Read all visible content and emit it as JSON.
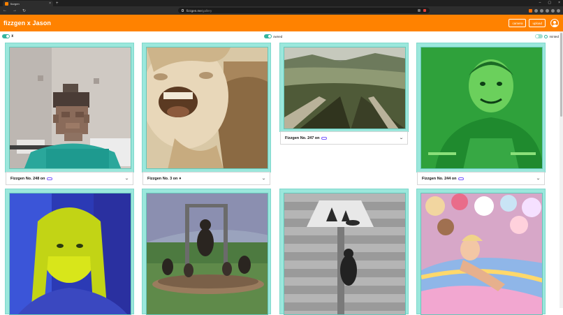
{
  "browser": {
    "tab_title": "fizzgen",
    "url_host": "fizzgen.me",
    "url_path": "/gallery"
  },
  "app": {
    "brand": "fizzgen x Jason",
    "camera_label": "camera",
    "upload_label": "upload"
  },
  "filters": {
    "owned_label": "owned",
    "minted_label": "minted"
  },
  "cards": [
    {
      "title": "Fizzgen No. 248 on",
      "chain": "chain-link-icon"
    },
    {
      "title": "Fizzgen No. 3 on",
      "chain": "ethereum-icon"
    },
    {
      "title": "Fizzgen No. 247 on",
      "chain": "chain-link-icon"
    },
    {
      "title": "Fizzgen No. 244 on",
      "chain": "chain-link-icon"
    }
  ],
  "colors": {
    "accent": "#ff8200",
    "card_border": "#9be7dc",
    "toggle": "#35b6a0"
  }
}
